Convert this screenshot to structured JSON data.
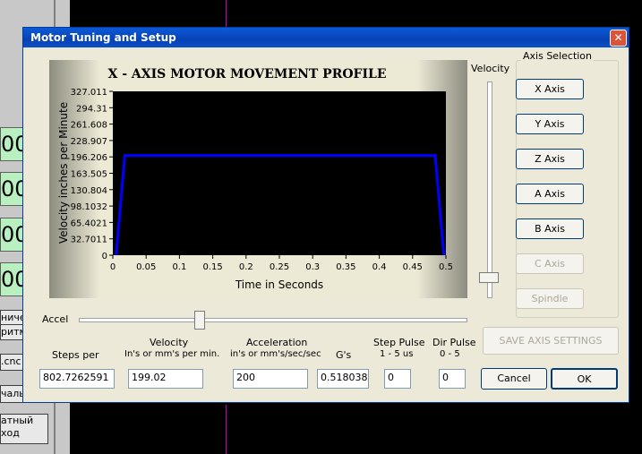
{
  "background": {
    "left_fragments": [
      "00",
      "00",
      "00",
      "00"
    ],
    "button_fragments": [
      "ничес",
      "ритм",
      ".cnc",
      "чаль",
      "атный\nход"
    ]
  },
  "window": {
    "title": "Motor Tuning and Setup",
    "close_glyph": "✕"
  },
  "chart_data": {
    "type": "line",
    "title": "X - AXIS MOTOR MOVEMENT PROFILE",
    "xlabel": "Time in Seconds",
    "ylabel": "Velocity inches per Minute",
    "x_ticks": [
      "0",
      "0.05",
      "0.1",
      "0.15",
      "0.2",
      "0.25",
      "0.3",
      "0.35",
      "0.4",
      "0.45",
      "0.5"
    ],
    "y_ticks": [
      "0",
      "32.7011",
      "65.4021",
      "98.1032",
      "130.804",
      "163.505",
      "196.206",
      "228.907",
      "261.608",
      "294.31",
      "327.011"
    ],
    "xlim": [
      0,
      0.5
    ],
    "ylim": [
      0,
      327.011
    ],
    "series": [
      {
        "color": "#0000ff",
        "x": [
          0.005,
          0.018,
          0.484,
          0.497
        ],
        "y": [
          0,
          199.02,
          199.02,
          0
        ]
      }
    ],
    "background": "#000000",
    "grid": false
  },
  "velocity_slider": {
    "label": "Velocity",
    "level": 0.08
  },
  "accel_slider": {
    "label": "Accel",
    "level": 0.31
  },
  "axis_selection": {
    "label": "Axis Selection",
    "buttons": [
      {
        "label": "X Axis",
        "enabled": true
      },
      {
        "label": "Y Axis",
        "enabled": true
      },
      {
        "label": "Z Axis",
        "enabled": true
      },
      {
        "label": "A Axis",
        "enabled": true
      },
      {
        "label": "B Axis",
        "enabled": true
      },
      {
        "label": "C Axis",
        "enabled": false
      },
      {
        "label": "Spindle",
        "enabled": false
      }
    ]
  },
  "save_button": {
    "label": "SAVE AXIS SETTINGS",
    "enabled": false
  },
  "fields": {
    "steps_per": {
      "label": "Steps per",
      "value": "802.7262591"
    },
    "velocity": {
      "label": "Velocity",
      "sublabel": "In's or mm's per min.",
      "value": "199.02"
    },
    "acceleration": {
      "label": "Acceleration",
      "sublabel": "in's or mm's/sec/sec",
      "value": "200"
    },
    "gs": {
      "label": "G's",
      "value": "0.5180380"
    },
    "step_pulse": {
      "label": "Step Pulse",
      "sublabel": "1 - 5 us",
      "value": "0"
    },
    "dir_pulse": {
      "label": "Dir Pulse",
      "sublabel": "0 - 5",
      "value": "0"
    }
  },
  "buttons": {
    "cancel": "Cancel",
    "ok": "OK"
  }
}
